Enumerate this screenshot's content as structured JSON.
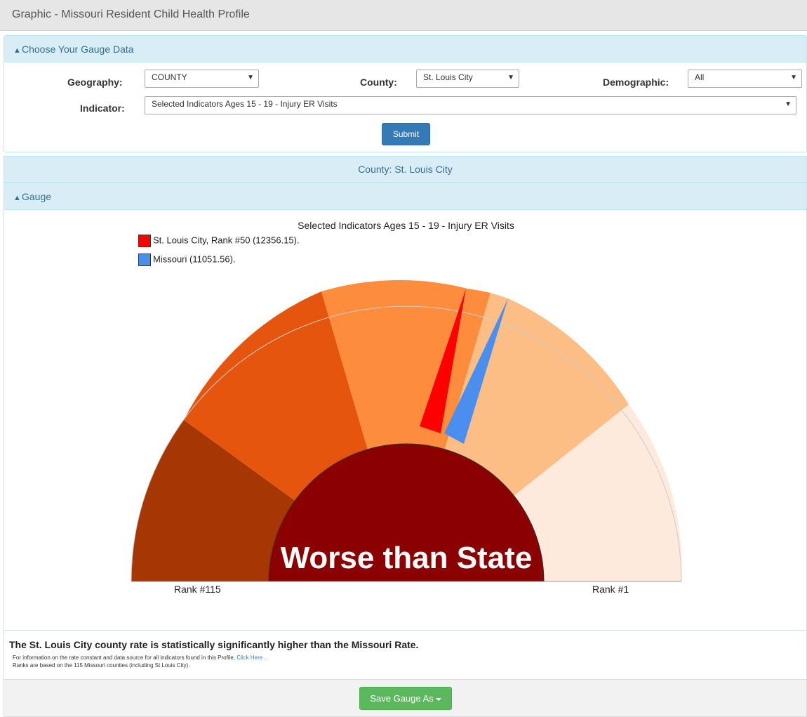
{
  "page": {
    "title": "Graphic - Missouri Resident Child Health Profile"
  },
  "choose_panel": {
    "heading": "Choose Your Gauge Data",
    "geography": {
      "label": "Geography:",
      "value": "COUNTY"
    },
    "county": {
      "label": "County:",
      "value": "St. Louis City"
    },
    "demographic": {
      "label": "Demographic:",
      "value": "All"
    },
    "indicator": {
      "label": "Indicator:",
      "value": "Selected Indicators Ages 15 - 19 - Injury ER Visits"
    },
    "submit_label": "Submit"
  },
  "county_heading": "County: St. Louis City",
  "gauge_panel": {
    "heading": "Gauge"
  },
  "colors": {
    "panel_heading_bg": "#d9edf7",
    "panel_heading_text": "#31708f",
    "submit": "#337ab7",
    "save": "#5cb85c",
    "center": "#8b0000"
  },
  "chart_data": {
    "type": "gauge",
    "title": "Selected Indicators Ages 15 - 19 - Injury ER Visits",
    "legend": [
      {
        "label": "St. Louis City, Rank #50 (12356.15).",
        "color": "#ff0000"
      },
      {
        "label": "Missouri (11051.56).",
        "color": "#4a8ef0"
      }
    ],
    "center_label": "Worse than State",
    "center_color": "#8b0000",
    "rank_left": "Rank #115",
    "rank_right": "Rank #1"
  },
  "footer": {
    "statement": "The St. Louis City county rate is statistically significantly higher than the Missouri Rate.",
    "info_text": "For information on the rate constant and data source for all indicators found in this Profile,",
    "info_link": "Click Here",
    "info_suffix": ".",
    "ranks_text": "Ranks are based on the 115 Missouri counties (including St Louis City)."
  },
  "save_button": {
    "label": "Save Gauge As"
  }
}
